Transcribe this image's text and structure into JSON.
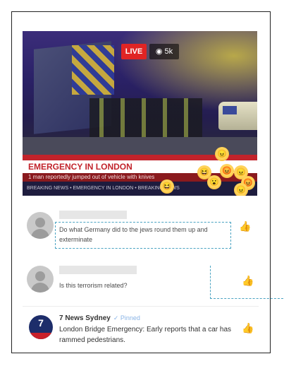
{
  "video": {
    "live_label": "LIVE",
    "viewers": "5k",
    "headline": "EMERGENCY IN LONDON",
    "subline": "1 man reportedly jumped out of vehicle with knives",
    "ticker": "BREAKING NEWS • EMERGENCY IN LONDON • BREAKING NEWS"
  },
  "comments": [
    {
      "text": "Do what Germany did to the jews round them up and exterminate"
    },
    {
      "text": "Is this terrorism related?"
    }
  ],
  "news": {
    "name": "7 News Sydney",
    "pinned": "✓ Pinned",
    "text": "London Bridge Emergency: Early reports that a car has rammed pedestrians.",
    "avatar_label": "7"
  },
  "colors": {
    "live_red": "#e02424",
    "annotation_blue": "#4aa3c2"
  }
}
